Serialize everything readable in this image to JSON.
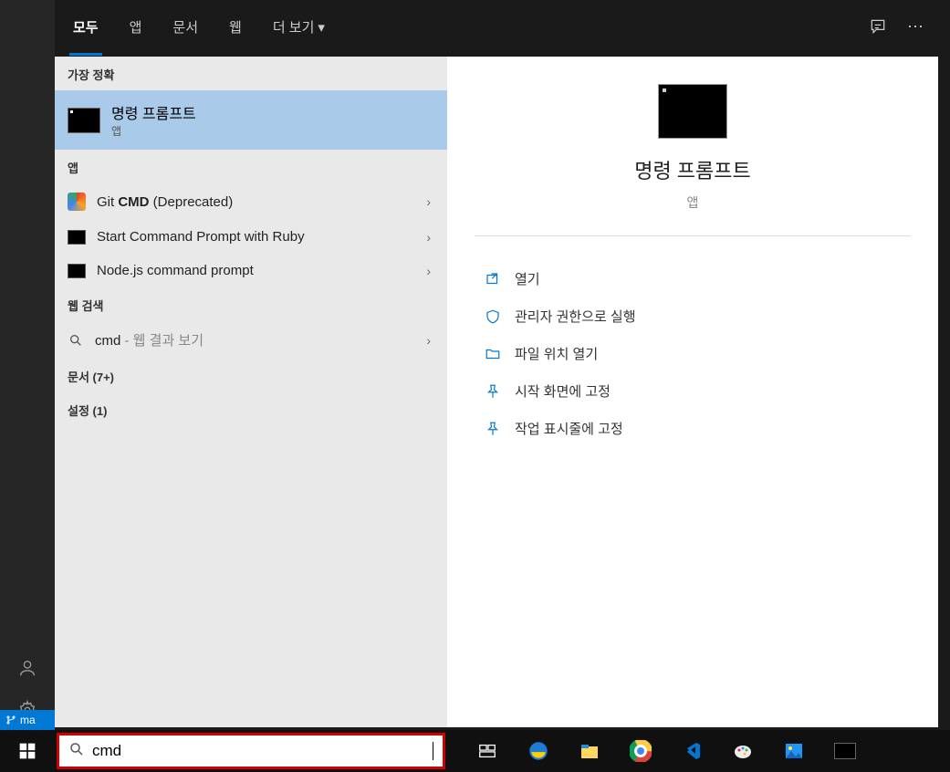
{
  "tabs": {
    "all": "모두",
    "apps": "앱",
    "documents": "문서",
    "web": "웹",
    "more": "더 보기"
  },
  "sections": {
    "best_match": "가장 정확",
    "apps": "앱",
    "web_search": "웹 검색",
    "documents": "문서 (7+)",
    "settings": "설정 (1)"
  },
  "best": {
    "title": "명령 프롬프트",
    "subtitle": "앱"
  },
  "apps": [
    {
      "label_pre": "Git ",
      "label_bold": "CMD",
      "label_post": " (Deprecated)",
      "icon": "git"
    },
    {
      "label_pre": "Start Command Prompt with Ruby",
      "label_bold": "",
      "label_post": "",
      "icon": "black"
    },
    {
      "label_pre": "Node.js command prompt",
      "label_bold": "",
      "label_post": "",
      "icon": "black"
    }
  ],
  "web": {
    "query": "cmd",
    "suffix": " - 웹 결과 보기"
  },
  "preview": {
    "title": "명령 프롬프트",
    "subtitle": "앱",
    "actions": [
      "열기",
      "관리자 권한으로 실행",
      "파일 위치 열기",
      "시작 화면에 고정",
      "작업 표시줄에 고정"
    ]
  },
  "search": {
    "value": "cmd"
  },
  "git_status": "ma"
}
